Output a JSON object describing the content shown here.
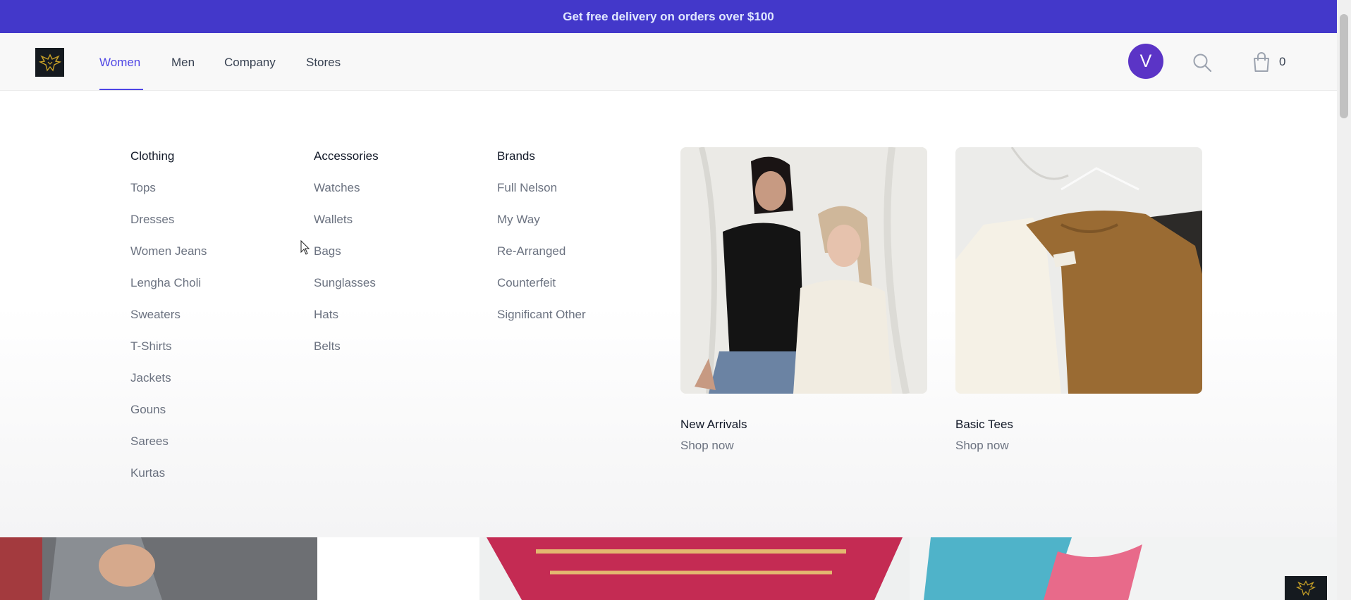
{
  "promo": {
    "text": "Get free delivery on orders over $100"
  },
  "brand": {
    "logo_icon": "eagle-logo-icon",
    "accent": "#4f46e5",
    "promo_bg": "#4338ca",
    "avatar_bg": "#5b34c6"
  },
  "nav": {
    "links": [
      {
        "label": "Women",
        "active": true
      },
      {
        "label": "Men",
        "active": false
      },
      {
        "label": "Company",
        "active": false
      },
      {
        "label": "Stores",
        "active": false
      }
    ],
    "avatar_initial": "V",
    "search_icon": "search-icon",
    "cart_icon": "shopping-bag-icon",
    "cart_count": "0"
  },
  "menu": {
    "columns": [
      {
        "title": "Clothing",
        "items": [
          "Tops",
          "Dresses",
          "Women Jeans",
          "Lengha Choli",
          "Sweaters",
          "T-Shirts",
          "Jackets",
          "Gouns",
          "Sarees",
          "Kurtas"
        ]
      },
      {
        "title": "Accessories",
        "items": [
          "Watches",
          "Wallets",
          "Bags",
          "Sunglasses",
          "Hats",
          "Belts"
        ]
      },
      {
        "title": "Brands",
        "items": [
          "Full Nelson",
          "My Way",
          "Re-Arranged",
          "Counterfeit",
          "Significant Other"
        ]
      }
    ],
    "features": [
      {
        "title": "New Arrivals",
        "cta": "Shop now"
      },
      {
        "title": "Basic Tees",
        "cta": "Shop now"
      }
    ]
  }
}
